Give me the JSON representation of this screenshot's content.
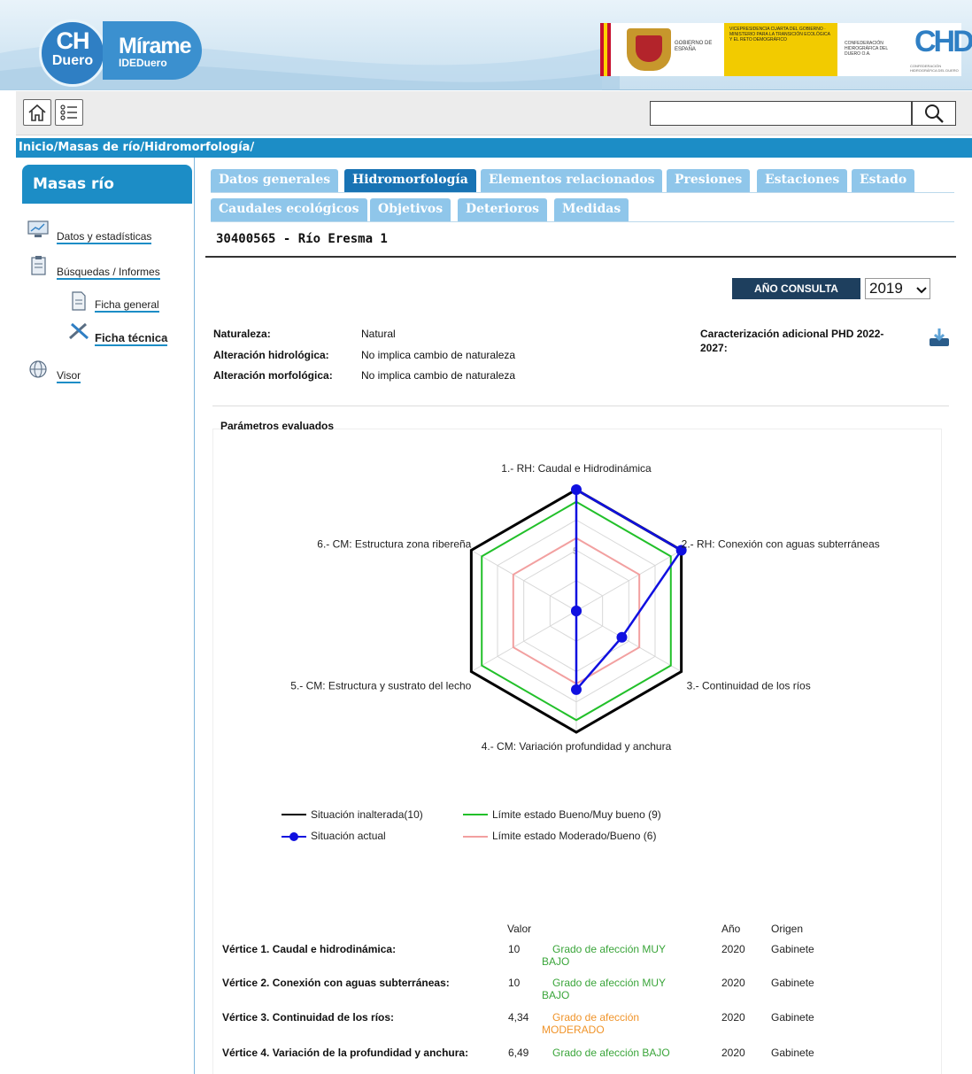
{
  "header": {
    "logo_ch_line1": "CH",
    "logo_ch_line2": "Duero",
    "logo_app_name": "Mírame",
    "logo_app_sub": "IDEDuero",
    "gov_text": "GOBIERNO DE ESPAÑA",
    "ministry_text": "VICEPRESIDENCIA CUARTA DEL GOBIERNO · MINISTERIO PARA LA TRANSICIÓN ECOLÓGICA Y EL RETO DEMOGRÁFICO",
    "chd_text": "CONFEDERACIÓN HIDROGRÁFICA DEL DUERO O.A.",
    "chd_logo": "CHD",
    "chd_sub": "CONFEDERACIÓN HIDROGRÁFICA DEL DUERO"
  },
  "toolbar": {
    "home_icon": "home-icon",
    "list_icon": "list-icon",
    "search_value": "",
    "search_icon": "search-icon"
  },
  "breadcrumb": "Inicio/Masas de río/Hidromorfología/",
  "sidebar": {
    "title": "Masas río",
    "items": [
      {
        "label": "Datos y estadísticas",
        "icon": "monitor-chart-icon"
      },
      {
        "label": "Búsquedas / Informes",
        "icon": "clipboard-icon"
      },
      {
        "label": "Ficha general",
        "icon": "document-icon"
      },
      {
        "label": "Ficha técnica",
        "icon": "tools-icon"
      },
      {
        "label": "Visor",
        "icon": "globe-icon"
      }
    ]
  },
  "tabs": {
    "row1": [
      "Datos generales",
      "Hidromorfología",
      "Elementos relacionados",
      "Presiones",
      "Estaciones",
      "Estado"
    ],
    "row2": [
      "Caudales ecológicos",
      "Objetivos",
      "Deterioros",
      "Medidas"
    ],
    "active": "Hidromorfología"
  },
  "body": {
    "title": "30400565 - Río Eresma 1",
    "year_label": "AÑO CONSULTA",
    "year_value": "2019",
    "naturaleza_key": "Naturaleza:",
    "naturaleza_val": "Natural",
    "alt_hidro_key": "Alteración hidrológica:",
    "alt_hidro_val": "No implica cambio de naturaleza",
    "alt_morfo_key": "Alteración morfológica:",
    "alt_morfo_val": "No implica cambio de naturaleza",
    "caract_label_1": "Caracterización adicional PHD 2022-",
    "caract_label_2": "2027:",
    "download_icon": "download-icon",
    "params_title": "Parámetros evaluados"
  },
  "chart_data": {
    "type": "radar",
    "axes": [
      "1.- RH: Caudal e Hidrodinámica",
      "2.- RH: Conexión con aguas subterráneas",
      "3.- Continuidad de los ríos",
      "4.- CM: Variación profundidad y anchura",
      "5.- CM: Estructura y sustrato del lecho",
      "6.- CM: Estructura zona ribereña"
    ],
    "range": [
      0,
      10
    ],
    "ring_labels": [
      "0",
      "5"
    ],
    "series": [
      {
        "name": "Situación inalterada(10)",
        "values": [
          10,
          10,
          10,
          10,
          10,
          10
        ],
        "color": "#000000"
      },
      {
        "name": "Límite estado Bueno/Muy bueno (9)",
        "values": [
          9,
          9,
          9,
          9,
          9,
          9
        ],
        "color": "#22c02a"
      },
      {
        "name": "Límite estado Moderado/Bueno (6)",
        "values": [
          6,
          6,
          6,
          6,
          6,
          6
        ],
        "color": "#f2a0a0"
      },
      {
        "name": "Situación actual",
        "values": [
          10,
          10,
          4.34,
          6.49,
          0,
          0
        ],
        "color": "#1010e0"
      }
    ],
    "legend_placement": "bottom"
  },
  "table": {
    "headers": {
      "valor": "Valor",
      "anio": "Año",
      "origen": "Origen"
    },
    "rows": [
      {
        "label": "Vértice 1. Caudal e hidrodinámica:",
        "valor": "10",
        "grado": "Grado de afección MUY BAJO",
        "grado_color": "#3aa53a",
        "anio": "2020",
        "origen": "Gabinete"
      },
      {
        "label": "Vértice 2. Conexión con aguas subterráneas:",
        "valor": "10",
        "grado": "Grado de afección MUY BAJO",
        "grado_color": "#3aa53a",
        "anio": "2020",
        "origen": "Gabinete"
      },
      {
        "label": "Vértice 3. Continuidad de los ríos:",
        "valor": "4,34",
        "grado": "Grado de afección MODERADO",
        "grado_color": "#f0942a",
        "anio": "2020",
        "origen": "Gabinete"
      },
      {
        "label": "Vértice 4. Variación de la profundidad y anchura:",
        "valor": "6,49",
        "grado": "Grado de afección BAJO",
        "grado_color": "#3aa53a",
        "anio": "2020",
        "origen": "Gabinete"
      }
    ]
  }
}
